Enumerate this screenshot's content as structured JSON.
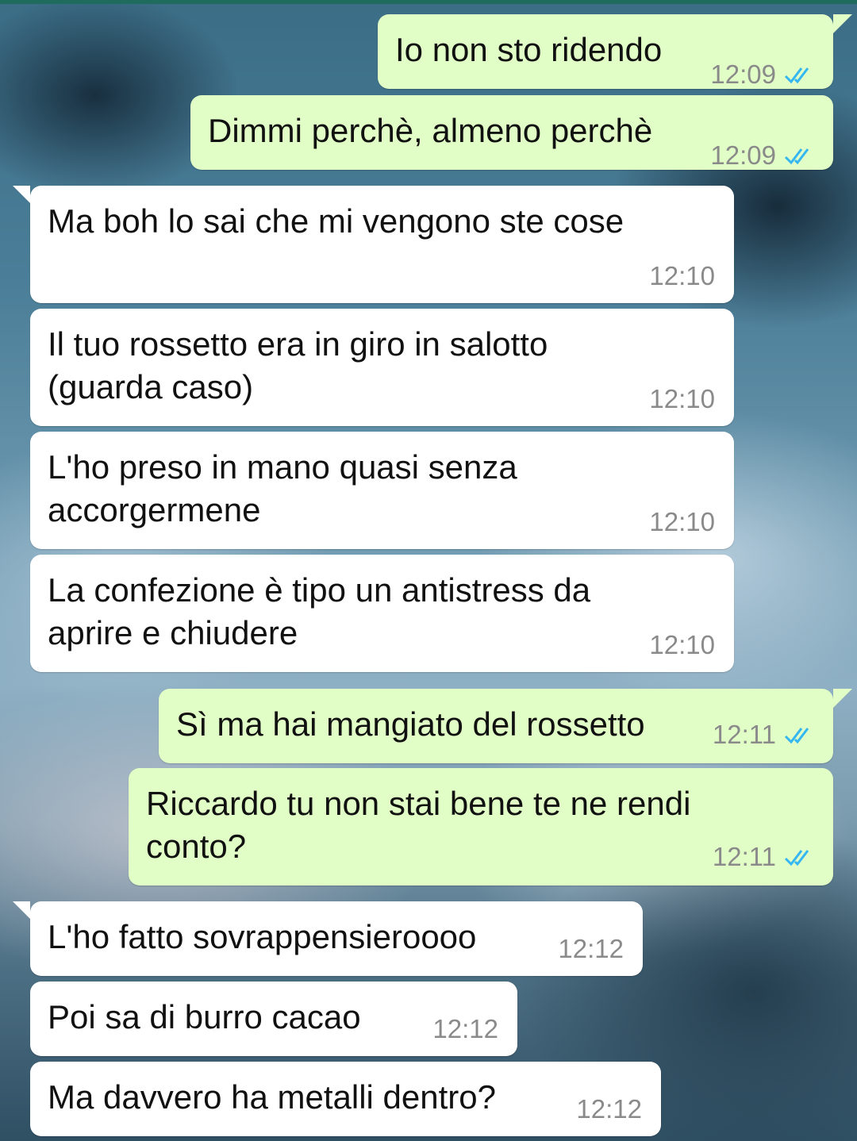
{
  "messages": [
    {
      "direction": "out",
      "text": "Io non sto ridendo",
      "time": "12:09",
      "status_icon": "double-check-read-icon"
    },
    {
      "direction": "out",
      "text": "Dimmi perchè, almeno perchè",
      "time": "12:09",
      "status_icon": "double-check-read-icon"
    },
    {
      "direction": "in",
      "text": "Ma boh lo sai che mi vengono ste cose",
      "time": "12:10"
    },
    {
      "direction": "in",
      "text": "Il tuo rossetto era in giro in salotto\n(guarda caso)",
      "time": "12:10"
    },
    {
      "direction": "in",
      "text": "L'ho preso in mano quasi senza\naccorgermene",
      "time": "12:10"
    },
    {
      "direction": "in",
      "text": "La confezione è tipo un antistress da\naprire e chiudere",
      "time": "12:10"
    },
    {
      "direction": "out",
      "text": "Sì ma hai mangiato del rossetto",
      "time": "12:11",
      "status_icon": "double-check-read-icon"
    },
    {
      "direction": "out",
      "text": "Riccardo tu non stai bene te ne rendi\nconto?",
      "time": "12:11",
      "status_icon": "double-check-read-icon"
    },
    {
      "direction": "in",
      "text": "L'ho fatto sovrappensieroooo",
      "time": "12:12"
    },
    {
      "direction": "in",
      "text": "Poi sa di burro cacao",
      "time": "12:12"
    },
    {
      "direction": "in",
      "text": "Ma davvero ha metalli dentro?",
      "time": "12:12"
    }
  ],
  "colors": {
    "outgoing_bubble": "#e1fec6",
    "incoming_bubble": "#ffffff",
    "read_ticks": "#34b7f1",
    "timestamp": "#8a8a8a"
  }
}
